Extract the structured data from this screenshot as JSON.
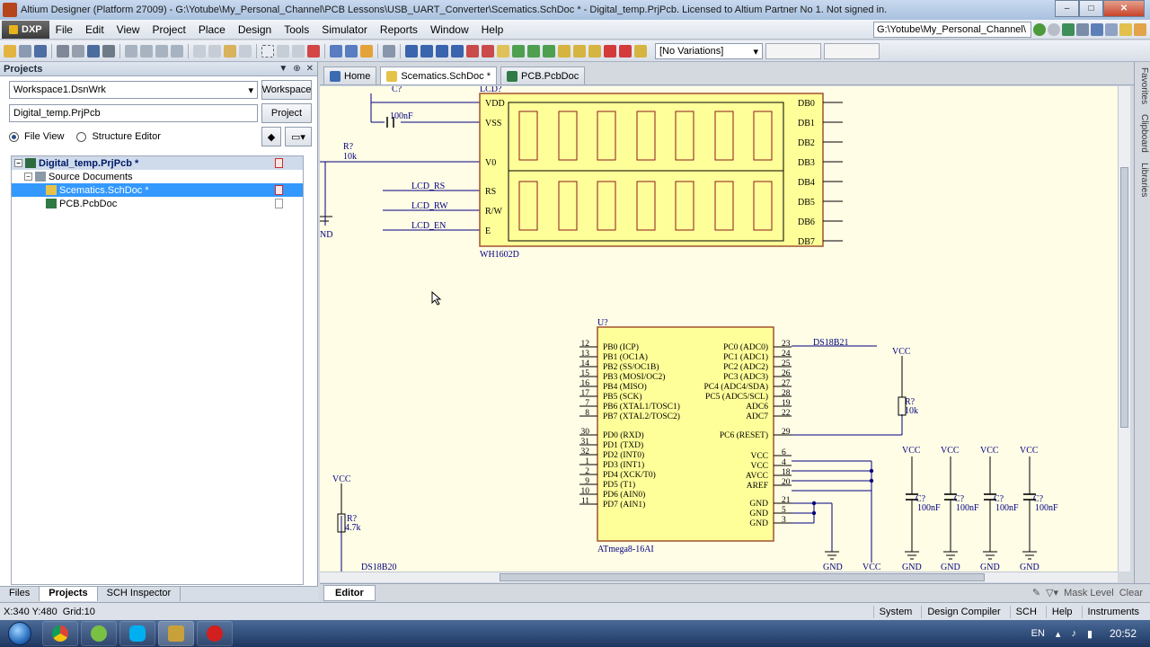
{
  "window": {
    "title": "Altium Designer (Platform 27009) - G:\\Yotube\\My_Personal_Channel\\PCB Lessons\\USB_UART_Converter\\Scematics.SchDoc * - Digital_temp.PrjPcb. Licensed to Altium Partner No 1. Not signed in.",
    "min": "–",
    "max": "□",
    "close": "✕"
  },
  "menu": {
    "dxp": "DXP",
    "items": [
      "File",
      "Edit",
      "View",
      "Project",
      "Place",
      "Design",
      "Tools",
      "Simulator",
      "Reports",
      "Window",
      "Help"
    ],
    "path": "G:\\Yotube\\My_Personal_Channel\\"
  },
  "toolbar": {
    "variations": "[No Variations]"
  },
  "projects": {
    "title": "Projects",
    "workspace": "Workspace1.DsnWrk",
    "workspace_btn": "Workspace",
    "project": "Digital_temp.PrjPcb",
    "project_btn": "Project",
    "file_view": "File View",
    "structure_editor": "Structure Editor",
    "tree": {
      "root": "Digital_temp.PrjPcb *",
      "folder": "Source Documents",
      "docs": [
        "Scematics.SchDoc *",
        "PCB.PcbDoc"
      ]
    },
    "tabs": [
      "Files",
      "Projects",
      "SCH Inspector"
    ]
  },
  "doc_tabs": [
    "Home",
    "Scematics.SchDoc *",
    "PCB.PcbDoc"
  ],
  "editor": {
    "tab": "Editor",
    "mask_level": "Mask Level",
    "clear": "Clear"
  },
  "right_tabs": [
    "Favorites",
    "Clipboard",
    "Libraries"
  ],
  "status": {
    "coords": "X:340 Y:480",
    "grid": "Grid:10",
    "buttons": [
      "System",
      "Design Compiler",
      "SCH",
      "Help",
      "Instruments"
    ]
  },
  "taskbar": {
    "lang": "EN",
    "time": "20:52"
  },
  "schematic": {
    "lcd": {
      "designator": "LCD?",
      "part": "WH1602D",
      "left_pins": [
        "VDD",
        "VSS",
        "V0",
        "RS",
        "R/W",
        "E"
      ],
      "right_pins": [
        "DB0",
        "DB1",
        "DB2",
        "DB3",
        "DB4",
        "DB5",
        "DB6",
        "DB7"
      ]
    },
    "cap_top": {
      "designator": "C?",
      "value": "100nF"
    },
    "res_top": {
      "designator": "R?",
      "value": "10k"
    },
    "gnd_top": "ND",
    "nets": [
      "LCD_RS",
      "LCD_RW",
      "LCD_EN"
    ],
    "mcu": {
      "designator": "U?",
      "part": "ATmega8-16AI",
      "left_b": [
        "PB0 (ICP)",
        "PB1 (OC1A)",
        "PB2 (SS/OC1B)",
        "PB3 (MOSI/OC2)",
        "PB4 (MISO)",
        "PB5 (SCK)",
        "PB6 (XTAL1/TOSC1)",
        "PB7 (XTAL2/TOSC2)"
      ],
      "left_d": [
        "PD0 (RXD)",
        "PD1 (TXD)",
        "PD2 (INT0)",
        "PD3 (INT1)",
        "PD4 (XCK/T0)",
        "PD5 (T1)",
        "PD6 (AIN0)",
        "PD7 (AIN1)"
      ],
      "right_c": [
        "PC0 (ADC0)",
        "PC1 (ADC1)",
        "PC2 (ADC2)",
        "PC3 (ADC3)",
        "PC4 (ADC4/SDA)",
        "PC5 (ADC5/SCL)",
        "ADC6",
        "ADC7"
      ],
      "right_c_nums": [
        "23",
        "24",
        "25",
        "26",
        "27",
        "28",
        "19",
        "22"
      ],
      "reset": "PC6 (RESET)",
      "reset_num": "29",
      "power": [
        "VCC",
        "VCC",
        "AVCC",
        "AREF"
      ],
      "power_nums": [
        "6",
        "4",
        "18",
        "20"
      ],
      "gnd": [
        "GND",
        "GND",
        "GND"
      ],
      "gnd_nums": [
        "21",
        "5",
        "3"
      ],
      "left_b_nums": [
        "12",
        "13",
        "14",
        "15",
        "16",
        "17",
        "7",
        "8"
      ],
      "left_d_nums": [
        "30",
        "31",
        "32",
        "1",
        "2",
        "9",
        "10",
        "11"
      ]
    },
    "ds_net": "DS18B21",
    "res_reset": {
      "designator": "R?",
      "value": "10k",
      "vcc": "VCC"
    },
    "res_left": {
      "designator": "R?",
      "value": "4.7k",
      "vcc": "VCC",
      "net": "DS18B20"
    },
    "caps": {
      "designator": "C?",
      "value": "100nF",
      "vcc": "VCC",
      "gnd": "GND"
    },
    "gnd_label": "GND",
    "vcc_label": "VCC"
  }
}
